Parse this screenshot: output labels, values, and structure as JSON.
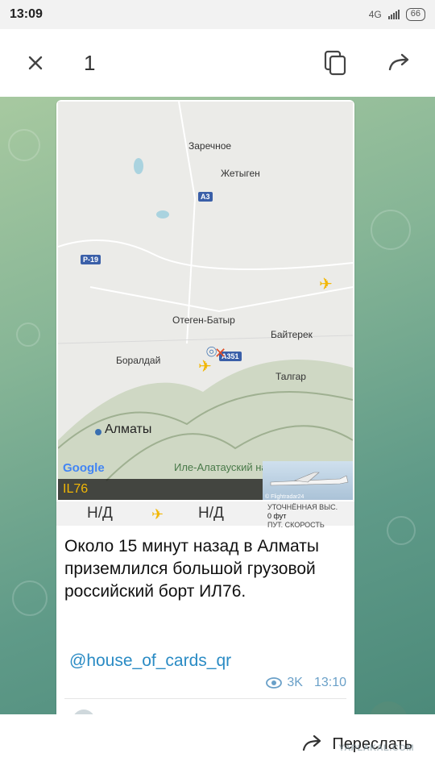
{
  "status_bar": {
    "time": "13:09",
    "network": "4G",
    "battery": "66"
  },
  "toolbar": {
    "close_icon": "close-icon",
    "count": "1",
    "copy_icon": "copy-icon",
    "share_icon": "forward-arrow-icon"
  },
  "map": {
    "labels": {
      "zarechnoe": "Заречное",
      "zhetygen": "Жетыген",
      "otegen": "Отеген-Батыр",
      "bayterek": "Байтерек",
      "boraldai": "Боралдай",
      "talgar": "Талгар",
      "almaty": "Алматы",
      "park": "Иле-Алатауский национальный парк"
    },
    "roads": {
      "a3": "A3",
      "r19": "P-19",
      "a351": "A351"
    },
    "google": "Google",
    "flight_code": "IL76",
    "photo_credit": "© Flightradar24"
  },
  "info_panel": {
    "left_value": "Н/Д",
    "right_value": "Н/Д",
    "alt_label": "УТОЧНЁННАЯ ВЫС.",
    "alt_value": "0 фут",
    "speed_label": "ПУТ. СКОРОСТЬ"
  },
  "message": {
    "text": "Около 15 минут назад в Алматы приземлился большой грузовой российский борт ИЛ76.",
    "link": "@house_of_cards_qr",
    "views": "3K",
    "time": "13:10"
  },
  "bottom_bar": {
    "forward_label": "Переслать",
    "watermark": "YAPLAKAL.COM"
  },
  "colors": {
    "link": "#2a8bc4",
    "flight_code": "#f2b705",
    "meta": "#6aa0c8"
  }
}
